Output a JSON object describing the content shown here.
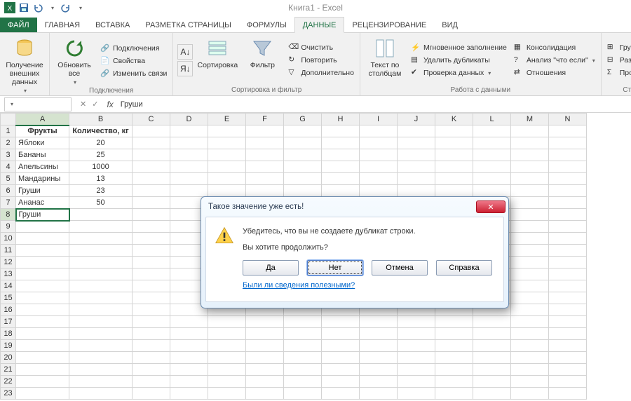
{
  "titlebar": {
    "title": "Книга1 - Excel"
  },
  "tabs": {
    "file": "ФАЙЛ",
    "items": [
      "ГЛАВНАЯ",
      "ВСТАВКА",
      "РАЗМЕТКА СТРАНИЦЫ",
      "ФОРМУЛЫ",
      "ДАННЫЕ",
      "РЕЦЕНЗИРОВАНИЕ",
      "ВИД"
    ],
    "active": "ДАННЫЕ"
  },
  "ribbon": {
    "groups": {
      "ext": {
        "label": "",
        "getdata": "Получение\nвнешних данных"
      },
      "conn": {
        "label": "Подключения",
        "refresh": "Обновить\nвсе",
        "items": [
          "Подключения",
          "Свойства",
          "Изменить связи"
        ]
      },
      "sort": {
        "label": "Сортировка и фильтр",
        "sortbtn": "Сортировка",
        "filter": "Фильтр",
        "items": [
          "Очистить",
          "Повторить",
          "Дополнительно"
        ]
      },
      "data": {
        "label": "Работа с данными",
        "text2col": "Текст по\nстолбцам",
        "col1": [
          "Мгновенное заполнение",
          "Удалить дубликаты",
          "Проверка данных"
        ],
        "col2": [
          "Консолидация",
          "Анализ \"что если\"",
          "Отношения"
        ]
      },
      "outline": {
        "label": "Ст",
        "items": [
          "Группир",
          "Разгруп",
          "Промеж"
        ]
      }
    }
  },
  "fbar": {
    "name": "",
    "formula": "Груши"
  },
  "columns": [
    "A",
    "B",
    "C",
    "D",
    "E",
    "F",
    "G",
    "H",
    "I",
    "J",
    "K",
    "L",
    "M",
    "N"
  ],
  "sheet": {
    "header": [
      "Фрукты",
      "Количество, кг"
    ],
    "rows": [
      [
        "Яблоки",
        "20"
      ],
      [
        "Бананы",
        "25"
      ],
      [
        "Апельсины",
        "1000"
      ],
      [
        "Мандарины",
        "13"
      ],
      [
        "Груши",
        "23"
      ],
      [
        "Ананас",
        "50"
      ]
    ],
    "editing": {
      "row": 8,
      "col": "A",
      "value": "Груши"
    },
    "visibleRows": 23
  },
  "dialog": {
    "title": "Такое значение уже есть!",
    "msg1": "Убедитесь, что вы не создаете дубликат строки.",
    "msg2": "Вы хотите продолжить?",
    "buttons": {
      "yes": "Да",
      "no": "Нет",
      "cancel": "Отмена",
      "help": "Справка"
    },
    "link": "Были ли сведения полезными?"
  }
}
